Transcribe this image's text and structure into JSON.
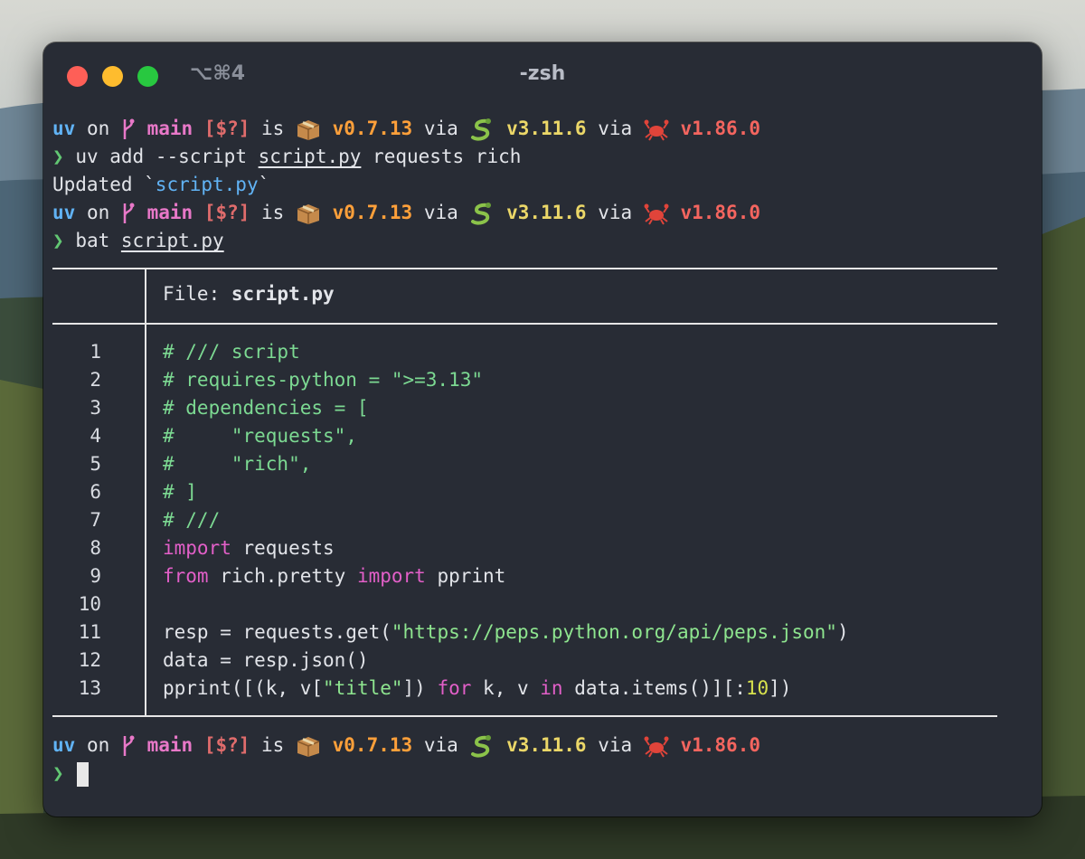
{
  "window": {
    "title": "-zsh",
    "shortcut": "⌥⌘4"
  },
  "prompt": {
    "dir": "uv",
    "on": "on",
    "branch": "main",
    "git_status": "[$?]",
    "is": "is",
    "package_version": "v0.7.13",
    "via": "via",
    "python_version": "v3.11.6",
    "rust_version": "v1.86.0"
  },
  "commands": {
    "add_prefix": "uv add --script ",
    "add_file": "script.py",
    "add_suffix": " requests rich",
    "updated_prefix": "Updated `",
    "updated_file": "script.py",
    "updated_suffix": "`",
    "bat_prefix": "bat ",
    "bat_file": "script.py"
  },
  "bat": {
    "file_label": "File: ",
    "file_name": "script.py",
    "line_numbers": [
      "1",
      "2",
      "3",
      "4",
      "5",
      "6",
      "7",
      "8",
      "9",
      "10",
      "11",
      "12",
      "13"
    ]
  },
  "code": {
    "l1": "# /// script",
    "l2": "# requires-python = \">=3.13\"",
    "l3": "# dependencies = [",
    "l4": "#     \"requests\",",
    "l5": "#     \"rich\",",
    "l6": "# ]",
    "l7": "# ///",
    "l8_kw": "import",
    "l8_rest": " requests",
    "l9_kw1": "from",
    "l9_mid": " rich.pretty ",
    "l9_kw2": "import",
    "l9_rest": " pprint",
    "l11_a": "resp = requests.get(",
    "l11_str": "\"https://peps.python.org/api/peps.json\"",
    "l11_b": ")",
    "l12": "data = resp.json()",
    "l13_a": "pprint([(k, v[",
    "l13_str": "\"title\"",
    "l13_b": "]) ",
    "l13_kw1": "for",
    "l13_c": " k, v ",
    "l13_kw2": "in",
    "l13_d": " data.items()][:",
    "l13_num": "10",
    "l13_e": "])"
  },
  "colors": {
    "terminal_bg": "#282c35",
    "dir": "#61b3f5",
    "branch": "#e878c8",
    "package": "#ffa03a",
    "python": "#ebd768",
    "rust": "#f4655f",
    "prompt_arrow": "#62c773",
    "comment": "#7cd992",
    "keyword": "#e25fc8",
    "string": "#8ee58f"
  },
  "icons": [
    "close-button",
    "minimize-button",
    "zoom-button",
    "git-branch-icon",
    "package-icon",
    "python-snake-icon",
    "rust-crab-icon",
    "prompt-chevron-icon"
  ]
}
